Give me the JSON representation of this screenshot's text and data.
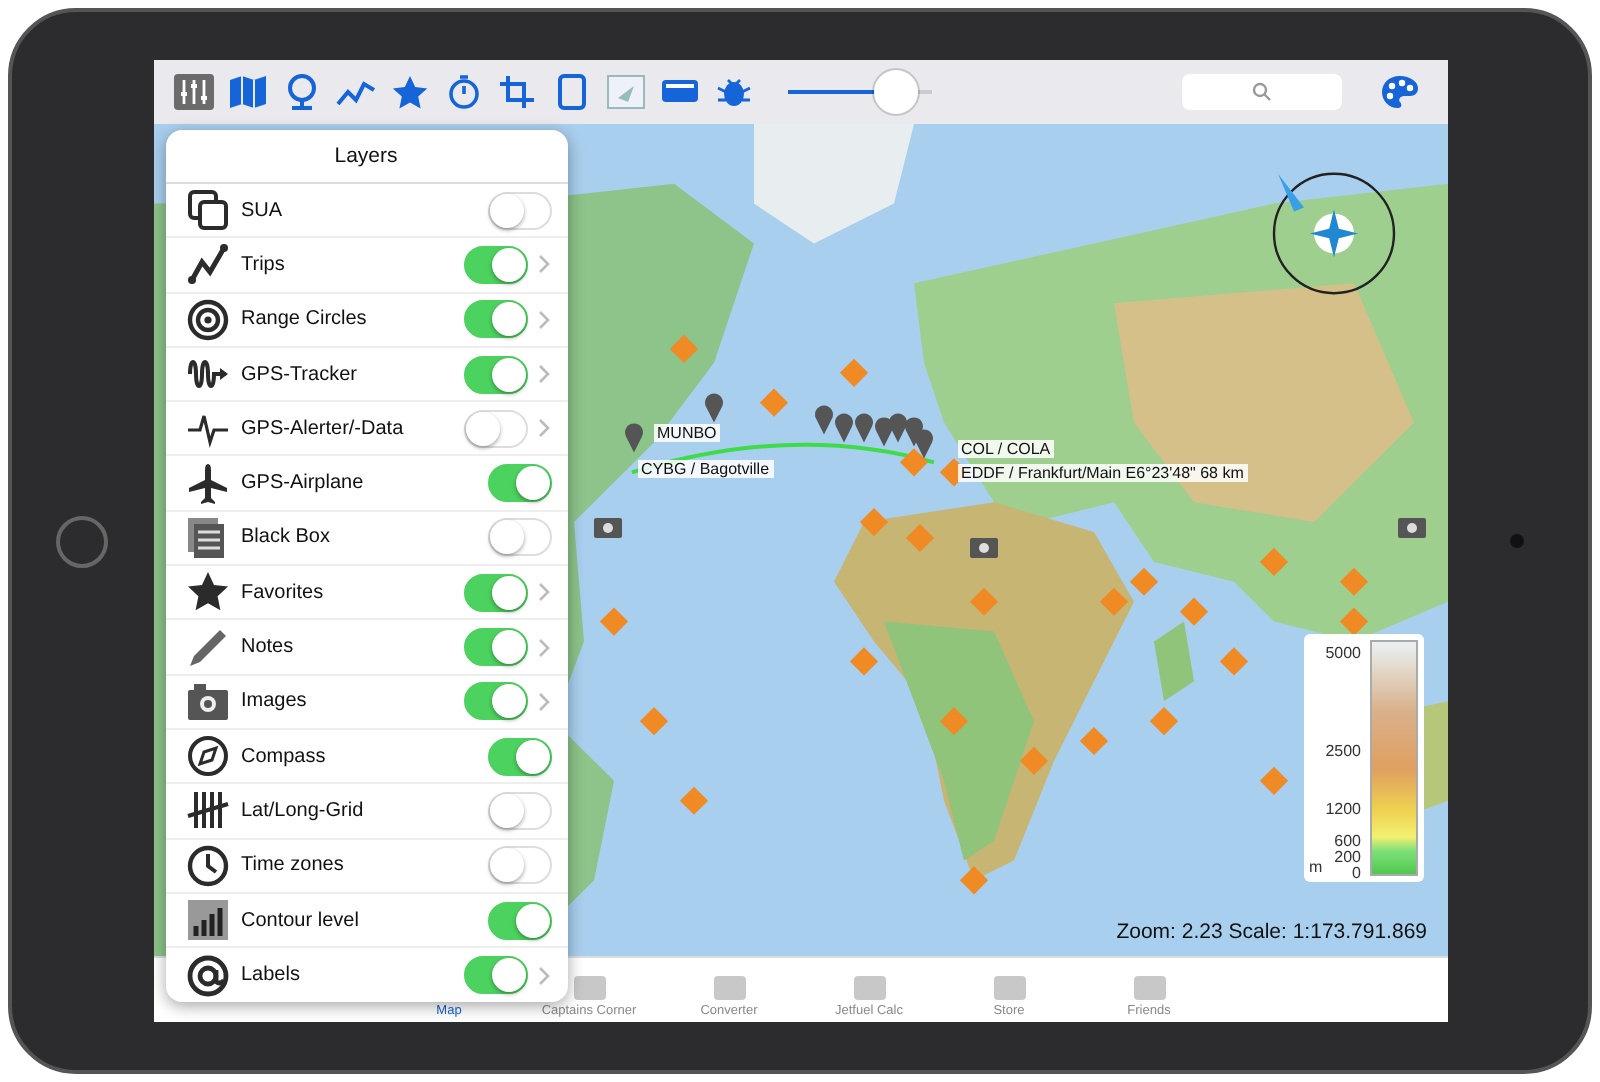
{
  "toolbar": {
    "buttons": [
      {
        "selected": true
      },
      {
        "selected": false
      },
      {
        "selected": false
      },
      {
        "selected": false
      },
      {
        "selected": false
      },
      {
        "selected": false
      },
      {
        "selected": false
      },
      {
        "selected": false
      },
      {
        "selected": false
      },
      {
        "selected": false
      },
      {
        "selected": false
      }
    ],
    "slider": {
      "level": 0.76
    }
  },
  "layers_panel": {
    "title": "Layers",
    "items": [
      {
        "label": "SUA",
        "on": false,
        "detail": false
      },
      {
        "label": "Trips",
        "on": true,
        "detail": true
      },
      {
        "label": "Range Circles",
        "on": true,
        "detail": true
      },
      {
        "label": "GPS-Tracker",
        "on": true,
        "detail": true
      },
      {
        "label": "GPS-Alerter/-Data",
        "on": false,
        "detail": true
      },
      {
        "label": "GPS-Airplane",
        "on": true,
        "detail": false
      },
      {
        "label": "Black Box",
        "on": false,
        "detail": false
      },
      {
        "label": "Favorites",
        "on": true,
        "detail": true
      },
      {
        "label": "Notes",
        "on": true,
        "detail": true
      },
      {
        "label": "Images",
        "on": true,
        "detail": true
      },
      {
        "label": "Compass",
        "on": true,
        "detail": false
      },
      {
        "label": "Lat/Long-Grid",
        "on": false,
        "detail": false
      },
      {
        "label": "Time zones",
        "on": false,
        "detail": false
      },
      {
        "label": "Contour level",
        "on": true,
        "detail": false
      },
      {
        "label": "Labels",
        "on": true,
        "detail": true
      }
    ]
  },
  "map": {
    "labels": [
      "MUNBO",
      "CYBG / Bagotville",
      "COL / COLA",
      "EDDF / Frankfurt/Main   E6°23'48\" 68 km"
    ],
    "legend": {
      "values": [
        "5000",
        "2500",
        "1200",
        "600",
        "200",
        "0"
      ],
      "unit": "m"
    },
    "status": "Zoom: 2.23  Scale: 1:173.791.869"
  },
  "tab_bar": [
    {
      "label": "Map",
      "selected": true
    },
    {
      "label": "Captains Corner",
      "selected": false
    },
    {
      "label": "Converter",
      "selected": false
    },
    {
      "label": "Jetfuel Calc",
      "selected": false
    },
    {
      "label": "Store",
      "selected": false
    },
    {
      "label": "Friends",
      "selected": false
    }
  ]
}
